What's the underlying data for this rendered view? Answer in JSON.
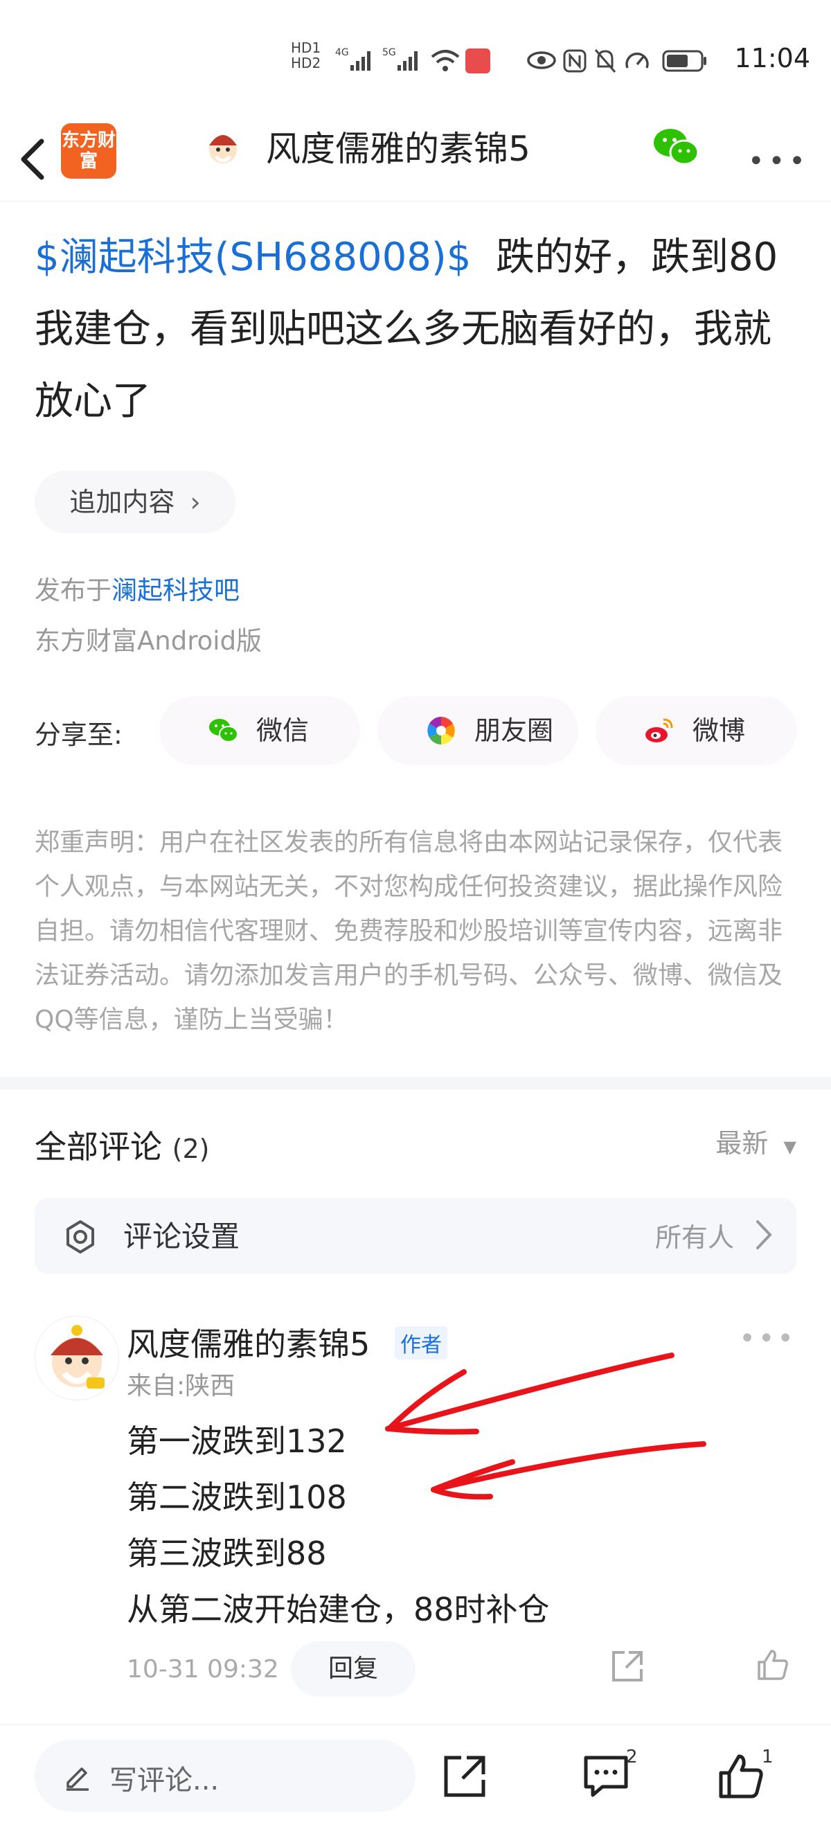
{
  "status_bar": {
    "time": "11:04",
    "network_labels": [
      "HD1",
      "HD2",
      "4G",
      "5G"
    ]
  },
  "header": {
    "logo_text": "东方财富",
    "title": "风度儒雅的素锦5"
  },
  "post": {
    "stock_link": "$澜起科技(SH688008)$",
    "body": "跌的好，跌到80我建仓，看到贴吧这么多无脑看好的，我就放心了",
    "add_content_label": "追加内容",
    "published_prefix": "发布于",
    "published_bar": "澜起科技吧",
    "client": "东方财富Android版"
  },
  "share": {
    "label": "分享至:",
    "options": [
      {
        "name": "wechat",
        "label": "微信",
        "icon": "wechat-icon"
      },
      {
        "name": "moments",
        "label": "朋友圈",
        "icon": "moments-icon"
      },
      {
        "name": "weibo",
        "label": "微博",
        "icon": "weibo-icon"
      }
    ]
  },
  "disclaimer": "郑重声明：用户在社区发表的所有信息将由本网站记录保存，仅代表个人观点，与本网站无关，不对您构成任何投资建议，据此操作风险自担。请勿相信代客理财、免费荐股和炒股培训等宣传内容，远离非法证券活动。请勿添加发言用户的手机号码、公众号、微博、微信及QQ等信息，谨防上当受骗！",
  "comments": {
    "title": "全部评论",
    "count": "(2)",
    "sort_label": "最新",
    "settings_label": "评论设置",
    "settings_value": "所有人",
    "items": [
      {
        "author": "风度儒雅的素锦5",
        "tag": "作者",
        "location": "来自:陕西",
        "lines": [
          "第一波跌到132",
          "第二波跌到108",
          "第三波跌到88",
          "从第二波开始建仓，88时补仓"
        ],
        "time": "10-31 09:32",
        "reply_label": "回复"
      }
    ]
  },
  "bottom_bar": {
    "write_placeholder": "写评论...",
    "comment_count": "2",
    "like_count": "1"
  },
  "colors": {
    "link": "#1a6fd6",
    "brand": "#f26321",
    "annotation": "#e8141a"
  }
}
